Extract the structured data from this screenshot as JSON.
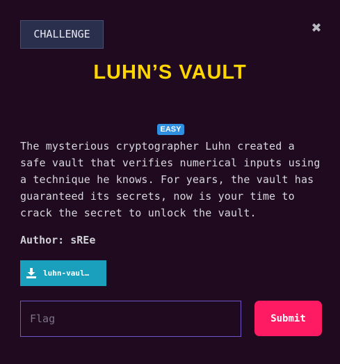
{
  "modal": {
    "tab_label": "CHALLENGE",
    "close_glyph": "✖",
    "title": "LUHN’S VAULT",
    "difficulty": "EASY",
    "description": "The mysterious cryptographer Luhn created a safe vault that verifies numerical inputs using a technique he knows. For years, the vault has guaranteed its secrets, now is your time to crack the secret to unlock the vault.",
    "author": "Author: sREe",
    "file_button": {
      "label": "luhn-vaul…",
      "icon": "download-icon"
    },
    "flag_input": {
      "value": "",
      "placeholder": "Flag"
    },
    "submit_label": "Submit"
  },
  "colors": {
    "background": "#1f0a1f",
    "title": "#ffd600",
    "difficulty_badge": "#2f8fe0",
    "file_button": "#1aa0bd",
    "submit_button": "#ff1a64",
    "input_border": "#6f57c9",
    "tab_badge": "#2b2f4e"
  }
}
